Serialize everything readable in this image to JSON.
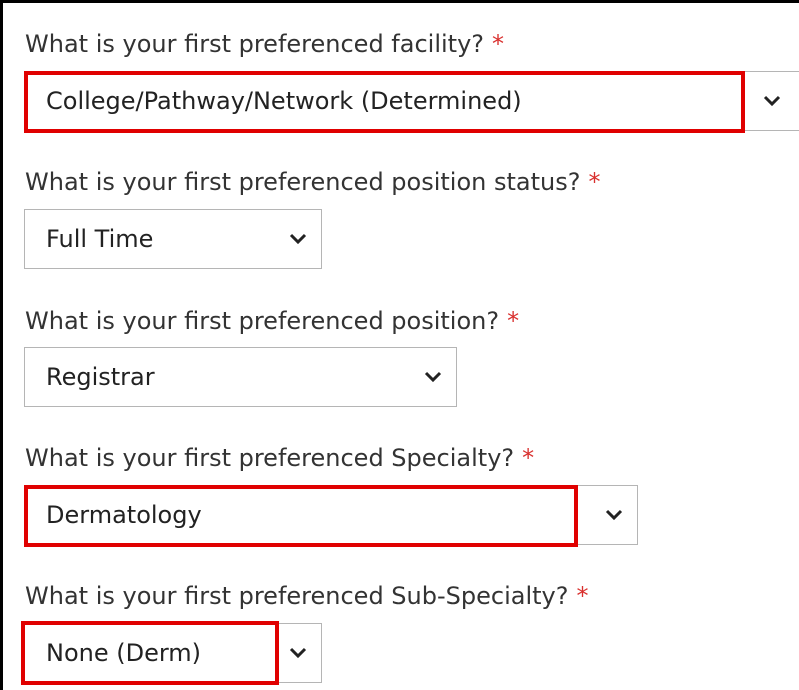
{
  "fields": [
    {
      "label": "What is your first preferenced facility?",
      "required": "*",
      "value": "College/Pathway/Network (Determined)",
      "chevron": "chevron-down-icon"
    },
    {
      "label": "What is your first preferenced position status?",
      "required": "*",
      "value": "Full Time",
      "chevron": "chevron-down-icon"
    },
    {
      "label": "What is your first preferenced position?",
      "required": "*",
      "value": "Registrar",
      "chevron": "chevron-down-icon"
    },
    {
      "label": "What is your first preferenced Specialty?",
      "required": "*",
      "value": "Dermatology",
      "chevron": "chevron-down-icon"
    },
    {
      "label": "What is your first preferenced Sub-Specialty?",
      "required": "*",
      "value": "None (Derm)",
      "chevron": "chevron-down-icon"
    }
  ],
  "colors": {
    "required_asterisk": "#d9302e",
    "highlight": "#e00000",
    "label_text": "#333333"
  }
}
